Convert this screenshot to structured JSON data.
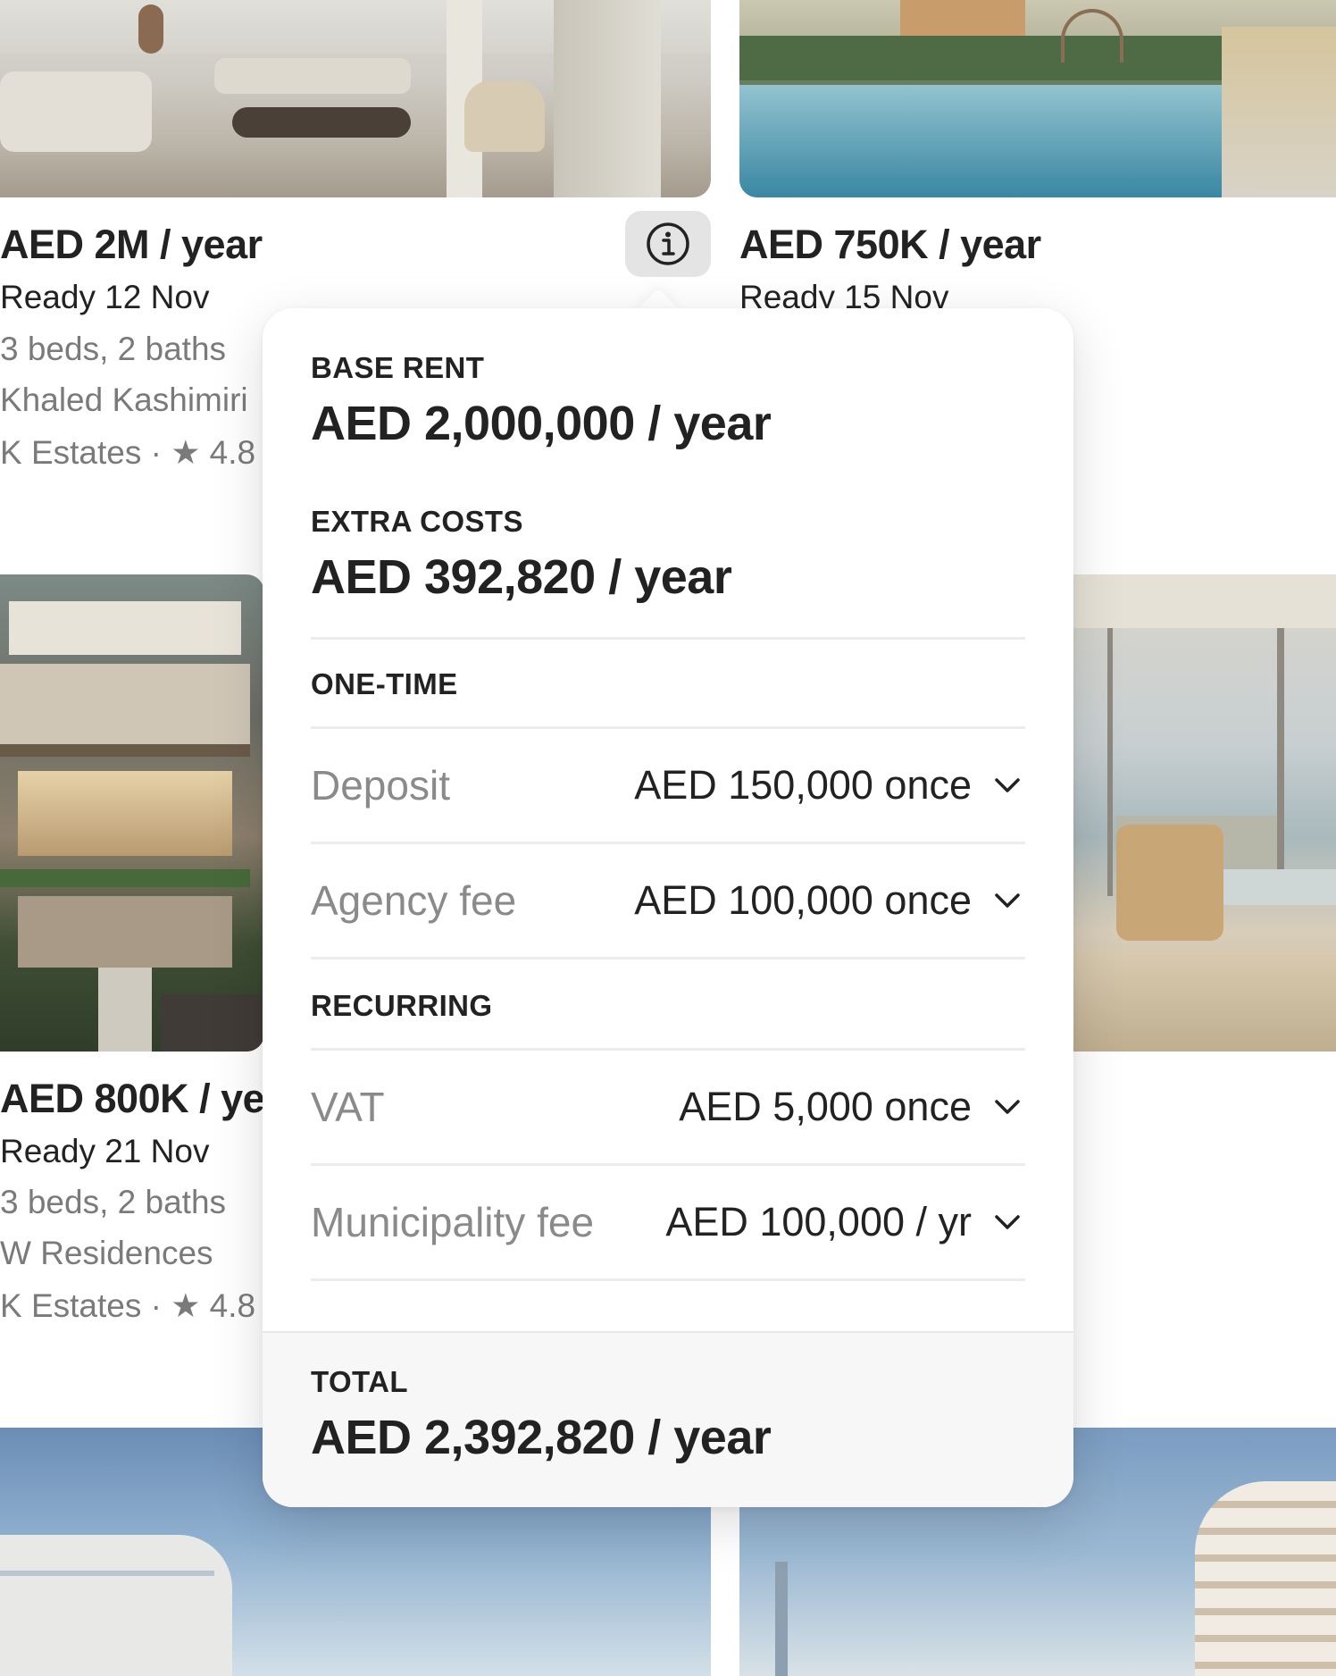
{
  "listings": [
    {
      "price": "AED 2M / year",
      "ready": "Ready 12 Nov",
      "beds_baths": "3 beds, 2 baths",
      "name": "Khaled Kashimiri",
      "agency_rating": "K Estates · ★ 4.8"
    },
    {
      "price": "AED 750K / year",
      "ready": "Ready 15 Nov"
    },
    {
      "price": "AED 800K / year",
      "ready": "Ready 21 Nov",
      "beds_baths": "3 beds, 2 baths",
      "name": "W Residences",
      "agency_rating": "K Estates · ★ 4.8"
    }
  ],
  "icons": {
    "info": "info-icon",
    "chevron": "chevron-down-icon"
  },
  "popover": {
    "base_rent": {
      "label": "BASE RENT",
      "value": "AED 2,000,000 / year"
    },
    "extra_costs": {
      "label": "EXTRA COSTS",
      "value": "AED 392,820 / year"
    },
    "one_time": {
      "label": "ONE-TIME",
      "items": [
        {
          "label": "Deposit",
          "value": "AED 150,000 once"
        },
        {
          "label": "Agency fee",
          "value": "AED 100,000 once"
        }
      ]
    },
    "recurring": {
      "label": "RECURRING",
      "items": [
        {
          "label": "VAT",
          "value": "AED 5,000 once"
        },
        {
          "label": "Municipality fee",
          "value": "AED 100,000 / yr"
        }
      ]
    },
    "total": {
      "label": "TOTAL",
      "value": "AED 2,392,820 / year"
    }
  },
  "colors": {
    "text_primary": "#222222",
    "text_secondary": "#8a8a8a",
    "divider": "#ececec",
    "info_button_bg": "#e4e4e4"
  }
}
